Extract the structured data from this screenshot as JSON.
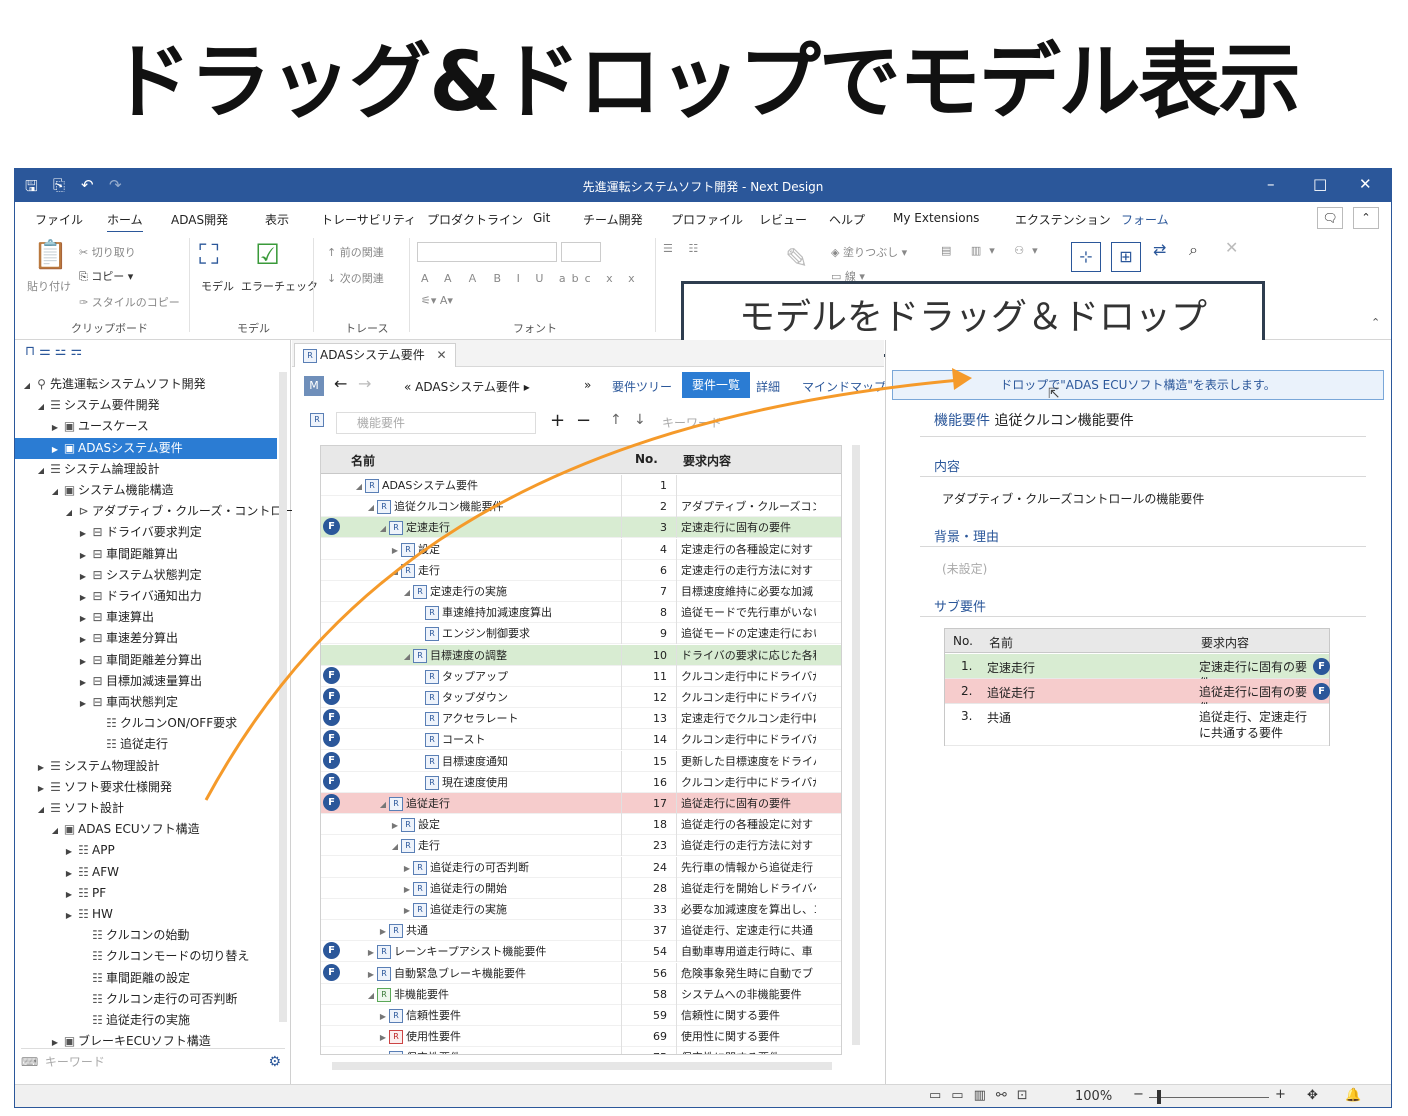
{
  "heading": "ドラッグ&ドロップでモデル表示",
  "window": {
    "title": "先進運転システムソフト開発 - Next Design"
  },
  "menu": {
    "tabs": [
      "ファイル",
      "ホーム",
      "ADAS開発",
      "表示",
      "トレーサビリティ",
      "プロダクトライン",
      "Git",
      "チーム開発",
      "プロファイル",
      "レビュー",
      "ヘルプ",
      "My Extensions",
      "エクステンション",
      "フォーム"
    ]
  },
  "ribbon": {
    "clipboard": {
      "paste": "貼り付け",
      "cut": "切り取り",
      "copy": "コピー",
      "style_copy": "スタイルのコピー",
      "group": "クリップボード"
    },
    "model": {
      "model": "モデル",
      "error_check": "エラーチェック",
      "group": "モデル"
    },
    "trace": {
      "prev": "前の関連",
      "next": "次の関連",
      "group": "トレース"
    },
    "font": {
      "group": "フォント"
    },
    "paint": {
      "fill": "塗りつぶし",
      "line": "線"
    }
  },
  "callout": "モデルをドラッグ＆ドロップ",
  "nav": {
    "search_placeholder": "キーワード",
    "tree": [
      {
        "label": "先進運転システムソフト開発",
        "indent": 0,
        "tw": "◢",
        "icon": "⚲"
      },
      {
        "label": "システム要件開発",
        "indent": 1,
        "tw": "◢",
        "icon": "☰"
      },
      {
        "label": "ユースケース",
        "indent": 2,
        "tw": "▶",
        "icon": "▣"
      },
      {
        "label": "ADASシステム要件",
        "indent": 2,
        "tw": "▶",
        "icon": "▣",
        "selected": true
      },
      {
        "label": "システム論理設計",
        "indent": 1,
        "tw": "◢",
        "icon": "☰"
      },
      {
        "label": "システム機能構造",
        "indent": 2,
        "tw": "◢",
        "icon": "▣"
      },
      {
        "label": "アダプティブ・クルーズ・コントロール",
        "indent": 3,
        "tw": "◢",
        "icon": "⊳"
      },
      {
        "label": "ドライバ要求判定",
        "indent": 4,
        "tw": "▶",
        "icon": "⊟"
      },
      {
        "label": "車間距離算出",
        "indent": 4,
        "tw": "▶",
        "icon": "⊟"
      },
      {
        "label": "システム状態判定",
        "indent": 4,
        "tw": "▶",
        "icon": "⊟"
      },
      {
        "label": "ドライバ通知出力",
        "indent": 4,
        "tw": "▶",
        "icon": "⊟"
      },
      {
        "label": "車速算出",
        "indent": 4,
        "tw": "▶",
        "icon": "⊟"
      },
      {
        "label": "車速差分算出",
        "indent": 4,
        "tw": "▶",
        "icon": "⊟"
      },
      {
        "label": "車間距離差分算出",
        "indent": 4,
        "tw": "▶",
        "icon": "⊟"
      },
      {
        "label": "目標加減速量算出",
        "indent": 4,
        "tw": "▶",
        "icon": "⊟"
      },
      {
        "label": "車両状態判定",
        "indent": 4,
        "tw": "▶",
        "icon": "⊟"
      },
      {
        "label": "クルコンON/OFF要求",
        "indent": 5,
        "tw": "",
        "icon": "☷"
      },
      {
        "label": "追従走行",
        "indent": 5,
        "tw": "",
        "icon": "☷"
      },
      {
        "label": "システム物理設計",
        "indent": 1,
        "tw": "▶",
        "icon": "☰"
      },
      {
        "label": "ソフト要求仕様開発",
        "indent": 1,
        "tw": "▶",
        "icon": "☰"
      },
      {
        "label": "ソフト設計",
        "indent": 1,
        "tw": "◢",
        "icon": "☰"
      },
      {
        "label": "ADAS ECUソフト構造",
        "indent": 2,
        "tw": "◢",
        "icon": "▣"
      },
      {
        "label": "APP",
        "indent": 3,
        "tw": "▶",
        "icon": "☷"
      },
      {
        "label": "AFW",
        "indent": 3,
        "tw": "▶",
        "icon": "☷"
      },
      {
        "label": "PF",
        "indent": 3,
        "tw": "▶",
        "icon": "☷"
      },
      {
        "label": "HW",
        "indent": 3,
        "tw": "▶",
        "icon": "☷"
      },
      {
        "label": "クルコンの始動",
        "indent": 4,
        "tw": "",
        "icon": "☷"
      },
      {
        "label": "クルコンモードの切り替え",
        "indent": 4,
        "tw": "",
        "icon": "☷"
      },
      {
        "label": "車間距離の設定",
        "indent": 4,
        "tw": "",
        "icon": "☷"
      },
      {
        "label": "クルコン走行の可否判断",
        "indent": 4,
        "tw": "",
        "icon": "☷"
      },
      {
        "label": "追従走行の実施",
        "indent": 4,
        "tw": "",
        "icon": "☷"
      },
      {
        "label": "ブレーキECUソフト構造",
        "indent": 2,
        "tw": "▶",
        "icon": "▣"
      }
    ]
  },
  "center": {
    "doc_tab": "ADASシステム要件",
    "breadcrumb": "ADASシステム要件",
    "views": [
      "要件ツリー",
      "要件一覧",
      "詳細",
      "マインドマップ"
    ],
    "active_view": "要件一覧",
    "filter_placeholder": "機能要件",
    "keyword_placeholder": "キーワード",
    "grid": {
      "columns": [
        "名前",
        "No.",
        "要求内容"
      ],
      "rows": [
        {
          "name": "ADASシステム要件",
          "indent": 1,
          "tw": "◢",
          "no": "1",
          "req": "",
          "badge": false,
          "color": "",
          "icon": "b"
        },
        {
          "name": "追従クルコン機能要件",
          "indent": 2,
          "tw": "◢",
          "no": "2",
          "req": "アダプティブ・クルーズコントロー",
          "badge": false,
          "color": "",
          "icon": "b"
        },
        {
          "name": "定速走行",
          "indent": 3,
          "tw": "◢",
          "no": "3",
          "req": "定速走行に固有の要件",
          "badge": true,
          "color": "green",
          "icon": "b"
        },
        {
          "name": "設定",
          "indent": 4,
          "tw": "▶",
          "no": "4",
          "req": "定速走行の各種設定に対す",
          "badge": false,
          "color": "",
          "icon": "b"
        },
        {
          "name": "走行",
          "indent": 4,
          "tw": "◢",
          "no": "6",
          "req": "定速走行の走行方法に対す",
          "badge": false,
          "color": "",
          "icon": "b"
        },
        {
          "name": "定速走行の実施",
          "indent": 5,
          "tw": "◢",
          "no": "7",
          "req": "目標速度維持に必要な加減",
          "badge": false,
          "color": "",
          "icon": "b"
        },
        {
          "name": "車速維持加減速度算出",
          "indent": 6,
          "tw": "",
          "no": "8",
          "req": "追従モードで先行車がいない",
          "badge": false,
          "color": "",
          "icon": "b"
        },
        {
          "name": "エンジン制御要求",
          "indent": 6,
          "tw": "",
          "no": "9",
          "req": "追従モードの定速走行におい",
          "badge": false,
          "color": "",
          "icon": "b"
        },
        {
          "name": "目標速度の調整",
          "indent": 5,
          "tw": "◢",
          "no": "10",
          "req": "ドライバの要求に応じた各種",
          "badge": false,
          "color": "green",
          "icon": "b"
        },
        {
          "name": "タップアップ",
          "indent": 6,
          "tw": "",
          "no": "11",
          "req": "クルコン走行中にドライバが目",
          "badge": true,
          "color": "",
          "icon": "b"
        },
        {
          "name": "タップダウン",
          "indent": 6,
          "tw": "",
          "no": "12",
          "req": "クルコン走行中にドライバが目",
          "badge": true,
          "color": "",
          "icon": "b"
        },
        {
          "name": "アクセラレート",
          "indent": 6,
          "tw": "",
          "no": "13",
          "req": "定速走行でクルコン走行中に",
          "badge": true,
          "color": "",
          "icon": "b"
        },
        {
          "name": "コースト",
          "indent": 6,
          "tw": "",
          "no": "14",
          "req": "クルコン走行中にドライバが目",
          "badge": true,
          "color": "",
          "icon": "b"
        },
        {
          "name": "目標速度通知",
          "indent": 6,
          "tw": "",
          "no": "15",
          "req": "更新した目標速度をドライバ",
          "badge": true,
          "color": "",
          "icon": "b"
        },
        {
          "name": "現在速度使用",
          "indent": 6,
          "tw": "",
          "no": "16",
          "req": "クルコン走行中にドライバが目",
          "badge": true,
          "color": "",
          "icon": "b"
        },
        {
          "name": "追従走行",
          "indent": 3,
          "tw": "◢",
          "no": "17",
          "req": "追従走行に固有の要件",
          "badge": true,
          "color": "red",
          "icon": "b"
        },
        {
          "name": "設定",
          "indent": 4,
          "tw": "▶",
          "no": "18",
          "req": "追従走行の各種設定に対す",
          "badge": false,
          "color": "",
          "icon": "b"
        },
        {
          "name": "走行",
          "indent": 4,
          "tw": "◢",
          "no": "23",
          "req": "追従走行の走行方法に対す",
          "badge": false,
          "color": "",
          "icon": "b"
        },
        {
          "name": "追従走行の可否判断",
          "indent": 5,
          "tw": "▶",
          "no": "24",
          "req": "先行車の情報から追従走行",
          "badge": false,
          "color": "",
          "icon": "b"
        },
        {
          "name": "追従走行の開始",
          "indent": 5,
          "tw": "▶",
          "no": "28",
          "req": "追従走行を開始しドライバへ",
          "badge": false,
          "color": "",
          "icon": "b"
        },
        {
          "name": "追従走行の実施",
          "indent": 5,
          "tw": "▶",
          "no": "33",
          "req": "必要な加減速度を算出し、コ",
          "badge": false,
          "color": "",
          "icon": "b"
        },
        {
          "name": "共通",
          "indent": 3,
          "tw": "▶",
          "no": "37",
          "req": "追従走行、定速走行に共通",
          "badge": false,
          "color": "",
          "icon": "b"
        },
        {
          "name": "レーンキープアシスト機能要件",
          "indent": 2,
          "tw": "▶",
          "no": "54",
          "req": "自動車専用道走行時に、車",
          "badge": true,
          "color": "",
          "icon": "b"
        },
        {
          "name": "自動緊急ブレーキ機能要件",
          "indent": 2,
          "tw": "▶",
          "no": "56",
          "req": "危険事象発生時に自動でブ",
          "badge": true,
          "color": "",
          "icon": "b"
        },
        {
          "name": "非機能要件",
          "indent": 2,
          "tw": "◢",
          "no": "58",
          "req": "システムへの非機能要件",
          "badge": false,
          "color": "",
          "icon": "g"
        },
        {
          "name": "信頼性要件",
          "indent": 3,
          "tw": "▶",
          "no": "59",
          "req": "信頼性に関する要件",
          "badge": false,
          "color": "",
          "icon": "b"
        },
        {
          "name": "使用性要件",
          "indent": 3,
          "tw": "▶",
          "no": "69",
          "req": "使用性に関する要件",
          "badge": false,
          "color": "",
          "icon": "r"
        },
        {
          "name": "保守性要件",
          "indent": 3,
          "tw": "▶",
          "no": "75",
          "req": "保守性に関する要件",
          "badge": false,
          "color": "",
          "icon": "b"
        }
      ]
    }
  },
  "right": {
    "drop_message": "ドロップで\"ADAS ECUソフト構造\"を表示します。",
    "type_label": "機能要件",
    "name": "追従クルコン機能要件",
    "content_label": "内容",
    "content": "アダプティブ・クルーズコントロールの機能要件",
    "reason_label": "背景・理由",
    "reason": "(未設定)",
    "sub_label": "サブ要件",
    "sub_table": {
      "columns": [
        "No.",
        "名前",
        "要求内容"
      ],
      "rows": [
        {
          "no": "1.",
          "name": "定速走行",
          "req": "定速走行に固有の要件",
          "color": "green",
          "badge": true
        },
        {
          "no": "2.",
          "name": "追従走行",
          "req": "追従走行に固有の要件",
          "color": "red",
          "badge": true
        },
        {
          "no": "3.",
          "name": "共通",
          "req": "追従走行、定速走行に共通する要件",
          "color": "",
          "badge": false
        }
      ]
    }
  },
  "status": {
    "zoom": "100%"
  },
  "colors": {
    "accent": "#2b579a",
    "arrow": "#f59a2a",
    "green_row": "#d8ecd2",
    "red_row": "#f6cccc"
  }
}
